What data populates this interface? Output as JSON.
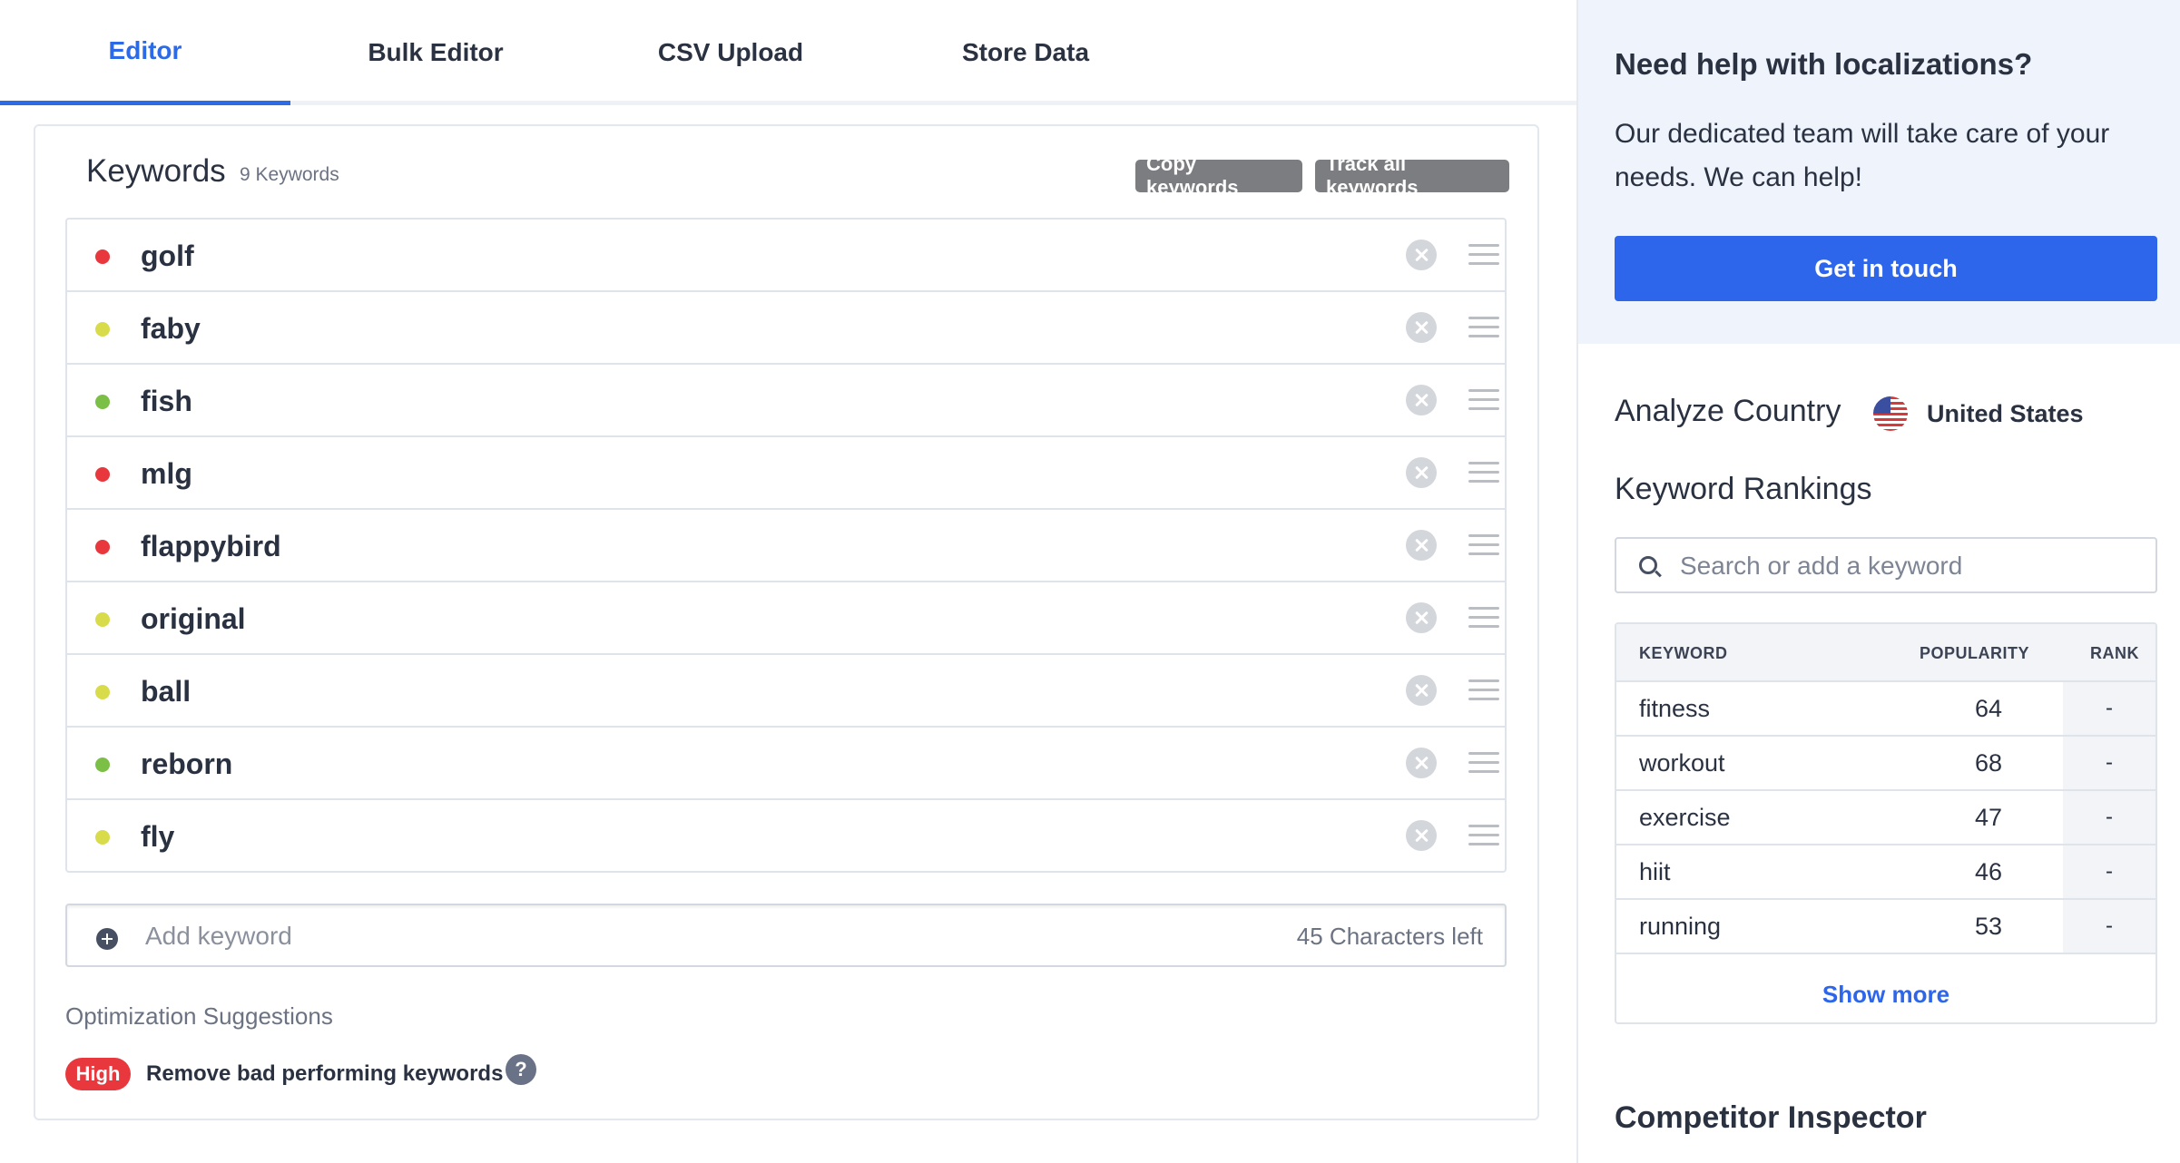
{
  "tabs": [
    {
      "label": "Editor",
      "active": true
    },
    {
      "label": "Bulk Editor",
      "active": false
    },
    {
      "label": "CSV Upload",
      "active": false
    },
    {
      "label": "Store Data",
      "active": false
    }
  ],
  "keywords_card": {
    "title": "Keywords",
    "count_label": "9 Keywords",
    "copy_label": "Copy keywords",
    "track_label": "Track all keywords",
    "items": [
      {
        "text": "golf",
        "status_color": "#e8383d"
      },
      {
        "text": "faby",
        "status_color": "#d8dc4a"
      },
      {
        "text": "fish",
        "status_color": "#7cbf46"
      },
      {
        "text": "mlg",
        "status_color": "#e8383d"
      },
      {
        "text": "flappybird",
        "status_color": "#e8383d"
      },
      {
        "text": "original",
        "status_color": "#d8dc4a"
      },
      {
        "text": "ball",
        "status_color": "#d8dc4a"
      },
      {
        "text": "reborn",
        "status_color": "#7cbf46"
      },
      {
        "text": "fly",
        "status_color": "#d8dc4a"
      }
    ],
    "add_placeholder": "Add keyword",
    "chars_left": "45 Characters left",
    "optimization": {
      "title": "Optimization Suggestions",
      "badge": "High",
      "text": "Remove bad performing keywords",
      "help_glyph": "?"
    }
  },
  "sidebar": {
    "help": {
      "title": "Need help with localizations?",
      "text": "Our dedicated team will take care of your needs. We can help!",
      "cta": "Get in touch"
    },
    "analyze_label": "Analyze Country",
    "country": "United States",
    "rankings_title": "Keyword Rankings",
    "search_placeholder": "Search or add a keyword",
    "table": {
      "headers": {
        "keyword": "KEYWORD",
        "popularity": "POPULARITY",
        "rank": "RANK"
      },
      "rows": [
        {
          "keyword": "fitness",
          "popularity": "64",
          "rank": "-"
        },
        {
          "keyword": "workout",
          "popularity": "68",
          "rank": "-"
        },
        {
          "keyword": "exercise",
          "popularity": "47",
          "rank": "-"
        },
        {
          "keyword": "hiit",
          "popularity": "46",
          "rank": "-"
        },
        {
          "keyword": "running",
          "popularity": "53",
          "rank": "-"
        }
      ],
      "show_more": "Show more"
    },
    "competitor_title": "Competitor Inspector"
  },
  "icons": {
    "remove": "close-circle-icon",
    "drag": "drag-handle-icon",
    "add": "plus-circle-icon",
    "help": "question-circle-icon",
    "flag": "us-flag-icon",
    "search": "search-icon"
  },
  "colors": {
    "accent": "#2d66ea",
    "bad": "#e8383d",
    "medium": "#d8dc4a",
    "good": "#7cbf46"
  }
}
